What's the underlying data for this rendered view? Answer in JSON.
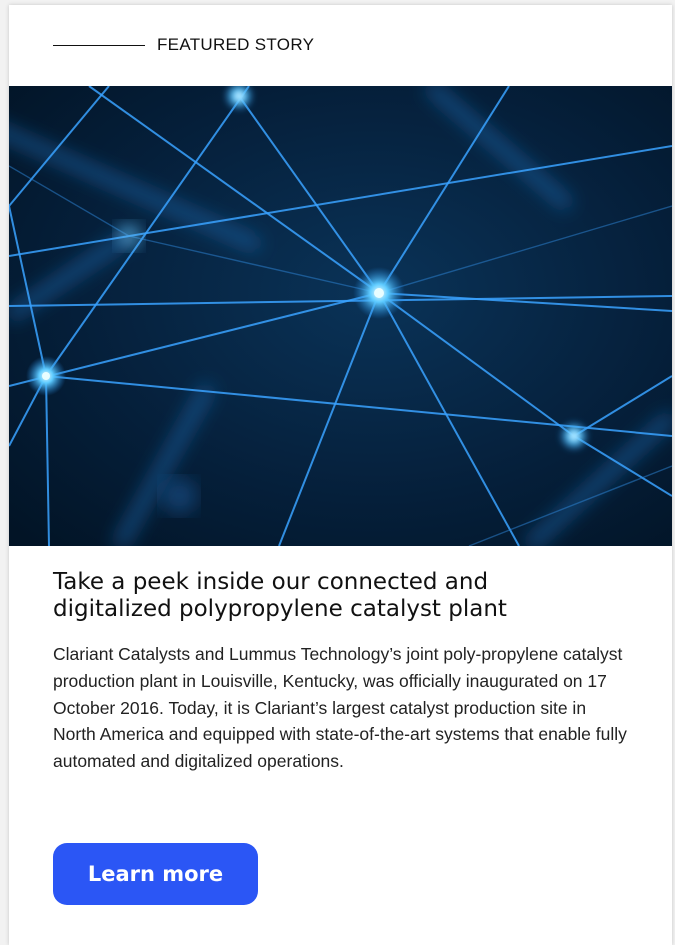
{
  "eyebrow": {
    "label": "FEATURED STORY"
  },
  "hero": {
    "image": "network-nodes-illustration"
  },
  "article": {
    "title": "Take a peek inside our connected and digitalized polypropylene catalyst plant",
    "body": "Clariant Catalysts and Lummus Technology’s joint poly-propylene catalyst production plant in Louisville, Kentucky, was officially inaugurated on 17 October 2016. Today, it is Clariant’s largest catalyst production site in North America and equipped with state-of-the-art systems that enable fully automated and digitalized operations."
  },
  "cta": {
    "label": "Learn more"
  },
  "colors": {
    "accent": "#2b56f5",
    "hero_bg": "#041c33",
    "glow": "#4fb6ff"
  }
}
